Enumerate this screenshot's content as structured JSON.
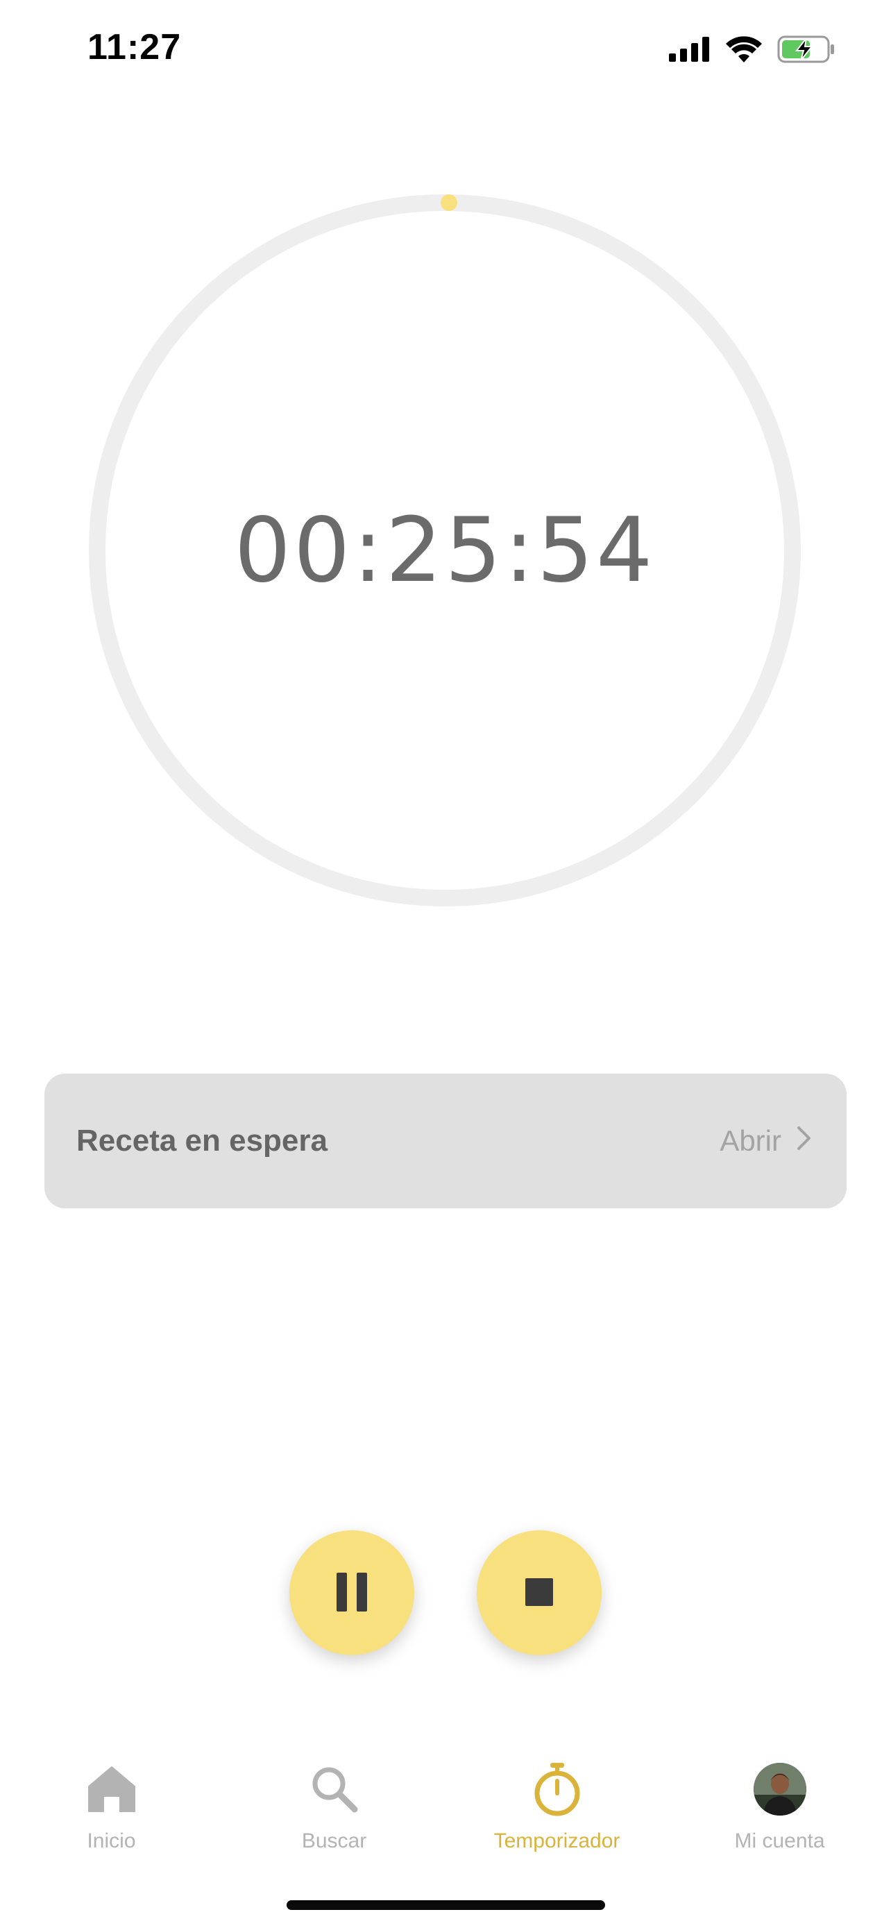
{
  "status_bar": {
    "time": "11:27",
    "icons": [
      "cellular-signal-icon",
      "wifi-icon",
      "battery-charging-icon"
    ]
  },
  "timer": {
    "display": "00:25:54",
    "progress": 0.0,
    "track_color": "#eeeeee",
    "progress_color": "#f8e07f"
  },
  "recipe_card": {
    "label": "Receta en espera",
    "action_label": "Abrir",
    "action_icon": "chevron-right-icon"
  },
  "controls": {
    "pause_icon": "pause-icon",
    "stop_icon": "stop-icon",
    "accent_color": "#f8e07f"
  },
  "tab_bar": {
    "active_color": "#d9b33a",
    "inactive_color": "#b3b3b3",
    "tabs": [
      {
        "label": "Inicio",
        "icon": "home-icon",
        "active": false
      },
      {
        "label": "Buscar",
        "icon": "search-icon",
        "active": false
      },
      {
        "label": "Temporizador",
        "icon": "stopwatch-icon",
        "active": true
      },
      {
        "label": "Mi cuenta",
        "icon": "avatar",
        "active": false
      }
    ]
  }
}
